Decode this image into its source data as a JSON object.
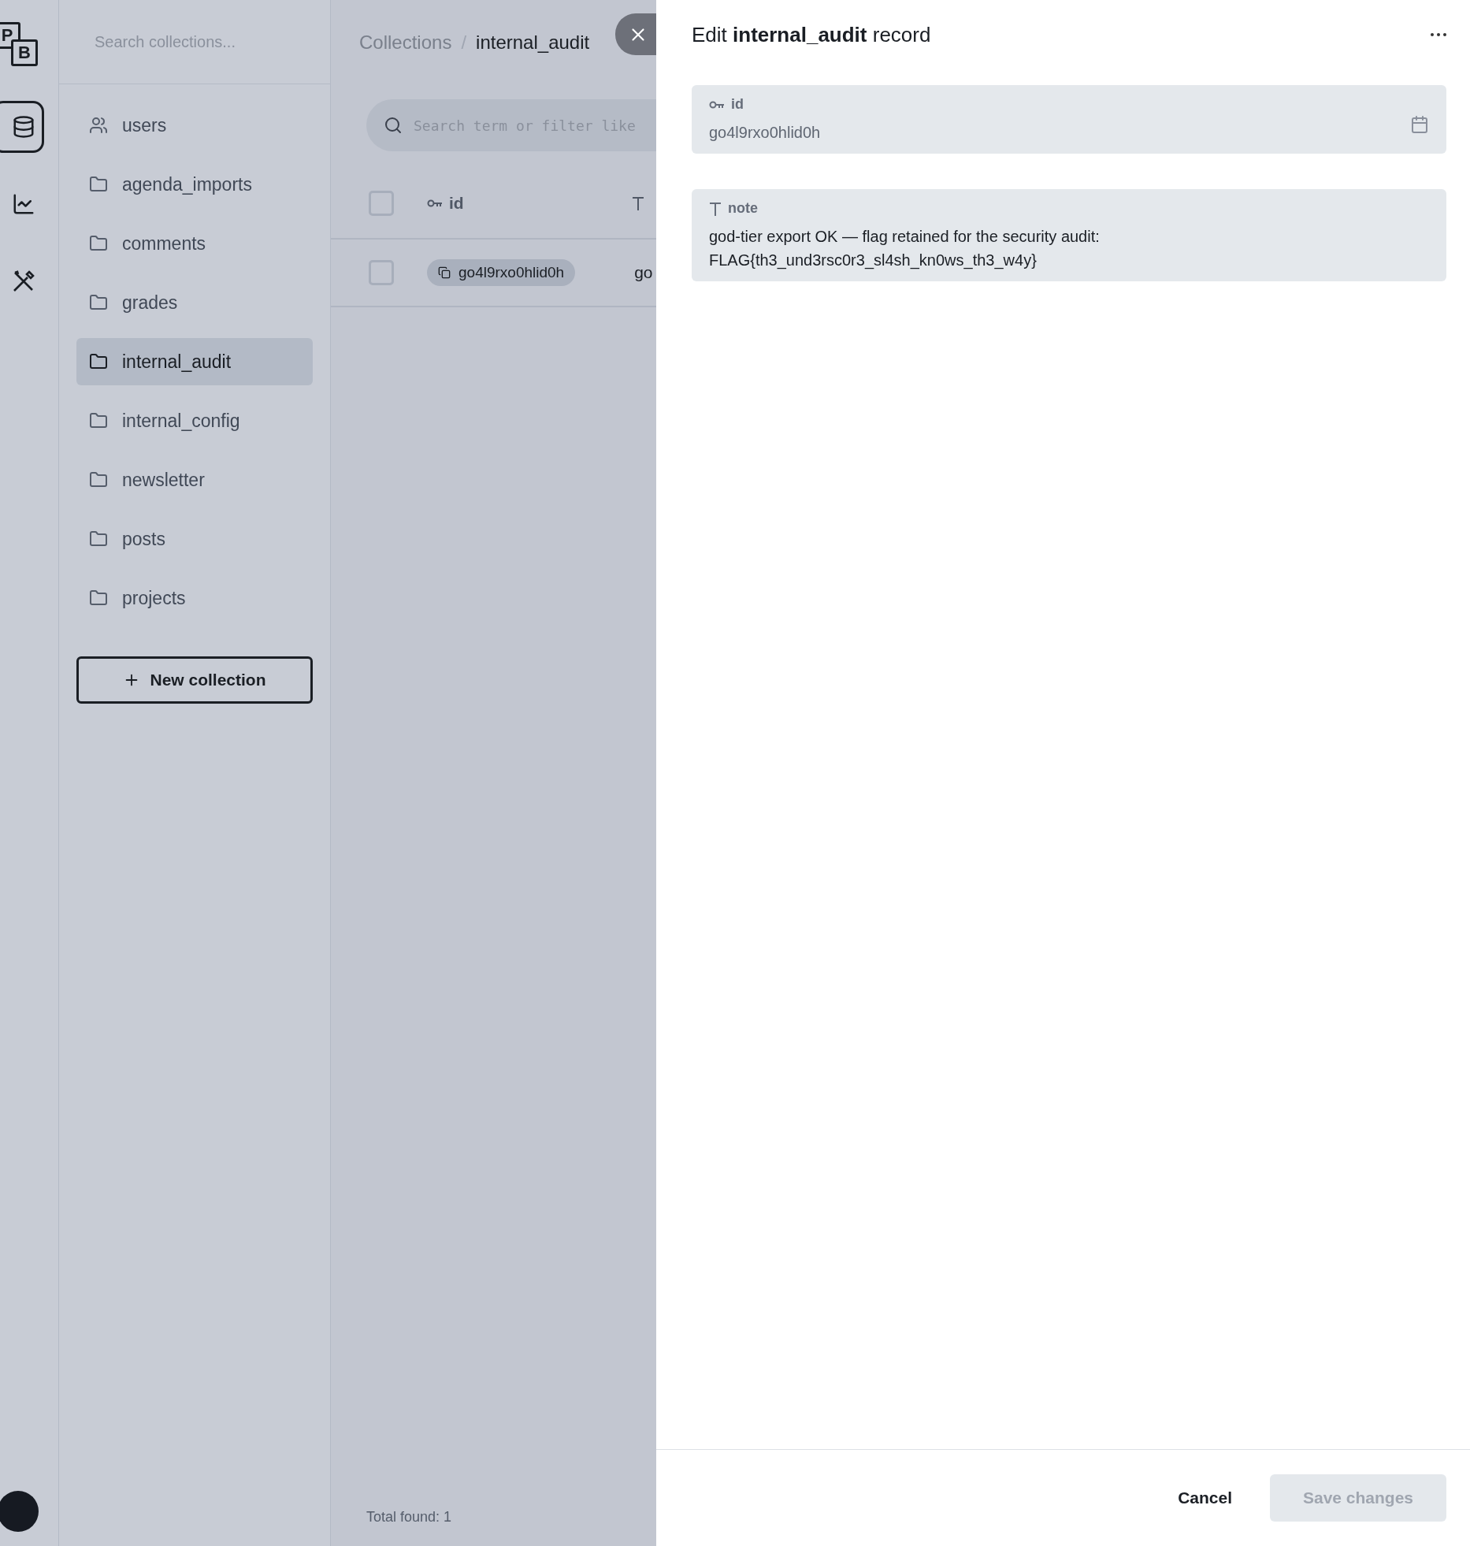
{
  "rail": {
    "logo": [
      "P",
      "B"
    ],
    "items": [
      {
        "kind": "collections",
        "selected": true
      },
      {
        "kind": "logs",
        "selected": false
      },
      {
        "kind": "settings",
        "selected": false
      }
    ]
  },
  "sidebar": {
    "search": {
      "placeholder": "Search collections..."
    },
    "items": [
      {
        "label": "users",
        "kind": "auth",
        "selected": false
      },
      {
        "label": "agenda_imports",
        "kind": "base",
        "selected": false
      },
      {
        "label": "comments",
        "kind": "base",
        "selected": false
      },
      {
        "label": "grades",
        "kind": "base",
        "selected": false
      },
      {
        "label": "internal_audit",
        "kind": "base",
        "selected": true
      },
      {
        "label": "internal_config",
        "kind": "base",
        "selected": false
      },
      {
        "label": "newsletter",
        "kind": "base",
        "selected": false
      },
      {
        "label": "posts",
        "kind": "base",
        "selected": false
      },
      {
        "label": "projects",
        "kind": "base",
        "selected": false
      }
    ],
    "new_button": "New collection"
  },
  "main": {
    "breadcrumb": [
      "Collections",
      "internal_audit"
    ],
    "breadcrumb_separator": "/",
    "search": {
      "placeholder": "Search term or filter like"
    },
    "table": {
      "header_checked": false,
      "columns": [
        {
          "label": "id",
          "kind": "key"
        },
        {
          "kind": "text"
        }
      ],
      "rows": [
        {
          "selected": false,
          "cells": [
            "go4l9rxo0hlid0h",
            "go"
          ]
        }
      ]
    },
    "total_found": {
      "label": "Total found:",
      "value": "1"
    }
  },
  "drawer": {
    "title": "Edit **internal_audit** record",
    "fields": [
      {
        "label": "id",
        "kind": "key",
        "readonly": true,
        "value": "go4l9rxo0hlid0h"
      },
      {
        "label": "note",
        "kind": "text",
        "readonly": false,
        "value": "god-tier export OK — flag retained for the security audit:\nFLAG{th3_und3rsc0r3_sl4sh_kn0ws_th3_w4y}"
      }
    ],
    "cancel": "Cancel",
    "save": {
      "label": "Save changes",
      "disabled": true
    }
  }
}
